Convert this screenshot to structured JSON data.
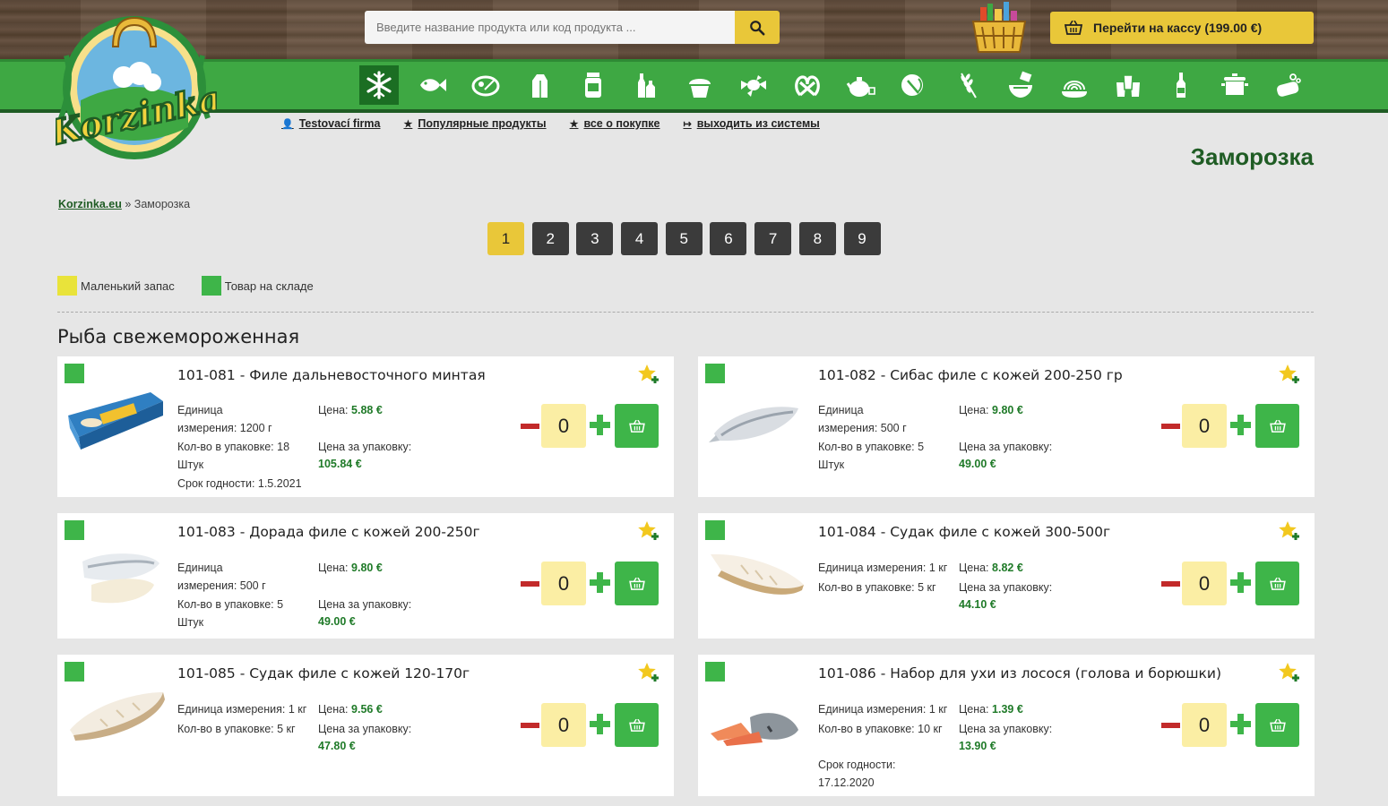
{
  "search": {
    "placeholder": "Введите название продукта или код продукта ..."
  },
  "checkout": {
    "label": "Перейти на кассу (199.00 €)"
  },
  "logo": {
    "text": "Korzinka"
  },
  "categories": [
    "frozen",
    "fish",
    "meat",
    "dairy",
    "jars",
    "drinks",
    "bakery",
    "candy",
    "snacks",
    "tea",
    "vegetables",
    "grain",
    "soups",
    "pasta",
    "cups",
    "wine",
    "cookware",
    "cleaning"
  ],
  "userlinks": [
    {
      "label": "Testovací firma",
      "icon": "user-icon"
    },
    {
      "label": "Популярные продукты",
      "icon": "star-icon"
    },
    {
      "label": "все о покупке",
      "icon": "star-icon"
    },
    {
      "label": "выходить из системы",
      "icon": "logout-icon"
    }
  ],
  "page_title": "Заморозка",
  "breadcrumb": {
    "home": "Korzinka.eu",
    "separator": "»",
    "current": "Заморозка"
  },
  "pagination": {
    "pages": [
      "1",
      "2",
      "3",
      "4",
      "5",
      "6",
      "7",
      "8",
      "9"
    ],
    "current": "1"
  },
  "legend": {
    "low_stock": {
      "label": "Маленький запас",
      "color": "#e9e33a"
    },
    "in_stock": {
      "label": "Товар на складе",
      "color": "#3eb549"
    }
  },
  "section_title": "Рыба свежемороженная",
  "products": [
    {
      "name": "101-081 - Филе дальневосточного минтая",
      "unit_label": "Единица",
      "unit_value": "измерения: 1200 г",
      "pack_label": "Кол-во в упаковке: 18",
      "pack_value": "Штук",
      "price_label": "Цена:",
      "price": "5.88 €",
      "pack_price_label": "Цена за упаковку:",
      "pack_price": "105.84 €",
      "expiry": "Срок годности: 1.5.2021",
      "qty": "0"
    },
    {
      "name": "101-082 - Сибас филе с кожей 200-250 гр",
      "unit_label": "Единица",
      "unit_value": "измерения: 500 г",
      "pack_label": "Кол-во в упаковке: 5",
      "pack_value": "Штук",
      "price_label": "Цена:",
      "price": "9.80 €",
      "pack_price_label": "Цена за упаковку:",
      "pack_price": "49.00 €",
      "qty": "0"
    },
    {
      "name": "101-083 - Дорада филе с кожей 200-250г",
      "unit_label": "Единица",
      "unit_value": "измерения: 500 г",
      "pack_label": "Кол-во в упаковке: 5",
      "pack_value": "Штук",
      "price_label": "Цена:",
      "price": "9.80 €",
      "pack_price_label": "Цена за упаковку:",
      "pack_price": "49.00 €",
      "qty": "0"
    },
    {
      "name": "101-084 - Судак филе с кожей 300-500г",
      "unit_label": "Единица измерения: 1 кг",
      "pack_label": "Кол-во в упаковке: 5 кг",
      "price_label": "Цена:",
      "price": "8.82 €",
      "pack_price_label": "Цена за упаковку:",
      "pack_price": "44.10 €",
      "qty": "0"
    },
    {
      "name": "101-085 - Судак филе с кожей 120-170г",
      "unit_label": "Единица измерения: 1 кг",
      "pack_label": "Кол-во в упаковке: 5 кг",
      "price_label": "Цена:",
      "price": "9.56 €",
      "pack_price_label": "Цена за упаковку:",
      "pack_price": "47.80 €",
      "qty": "0"
    },
    {
      "name": "101-086 - Набор для ухи из лосося (голова и борюшки)",
      "unit_label": "Единица измерения: 1 кг",
      "pack_label": "Кол-во в упаковке: 10 кг",
      "price_label": "Цена:",
      "price": "1.39 €",
      "pack_price_label": "Цена за упаковку:",
      "pack_price": "13.90 €",
      "expiry_label": "Срок годности:",
      "expiry_value": "17.12.2020",
      "qty": "0"
    }
  ]
}
